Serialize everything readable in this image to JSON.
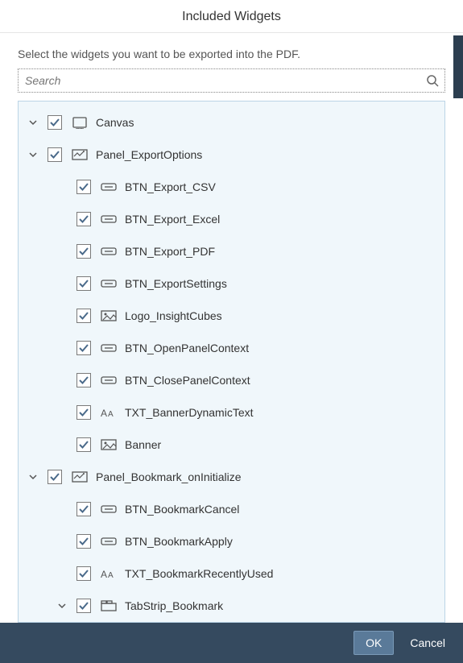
{
  "dialog": {
    "title": "Included Widgets",
    "instructions": "Select the widgets you want to be exported into the PDF."
  },
  "search": {
    "placeholder": "Search"
  },
  "tree": [
    {
      "label": "Canvas",
      "level": 0,
      "checked": true,
      "expandable": true,
      "expanded": true,
      "icon": "canvas"
    },
    {
      "label": "Panel_ExportOptions",
      "level": 1,
      "checked": true,
      "expandable": true,
      "expanded": true,
      "icon": "panel"
    },
    {
      "label": "BTN_Export_CSV",
      "level": 2,
      "checked": true,
      "expandable": false,
      "icon": "button"
    },
    {
      "label": "BTN_Export_Excel",
      "level": 2,
      "checked": true,
      "expandable": false,
      "icon": "button"
    },
    {
      "label": "BTN_Export_PDF",
      "level": 2,
      "checked": true,
      "expandable": false,
      "icon": "button"
    },
    {
      "label": "BTN_ExportSettings",
      "level": 2,
      "checked": true,
      "expandable": false,
      "icon": "button"
    },
    {
      "label": "Logo_InsightCubes",
      "level": 2,
      "checked": true,
      "expandable": false,
      "icon": "image"
    },
    {
      "label": "BTN_OpenPanelContext",
      "level": 2,
      "checked": true,
      "expandable": false,
      "icon": "button"
    },
    {
      "label": "BTN_ClosePanelContext",
      "level": 2,
      "checked": true,
      "expandable": false,
      "icon": "button"
    },
    {
      "label": "TXT_BannerDynamicText",
      "level": 2,
      "checked": true,
      "expandable": false,
      "icon": "text"
    },
    {
      "label": "Banner",
      "level": 2,
      "checked": true,
      "expandable": false,
      "icon": "image"
    },
    {
      "label": "Panel_Bookmark_onInitialize",
      "level": 1,
      "checked": true,
      "expandable": true,
      "expanded": true,
      "icon": "panel"
    },
    {
      "label": "BTN_BookmarkCancel",
      "level": 2,
      "checked": true,
      "expandable": false,
      "icon": "button"
    },
    {
      "label": "BTN_BookmarkApply",
      "level": 2,
      "checked": true,
      "expandable": false,
      "icon": "button"
    },
    {
      "label": "TXT_BookmarkRecentlyUsed",
      "level": 2,
      "checked": true,
      "expandable": false,
      "icon": "text"
    },
    {
      "label": "TabStrip_Bookmark",
      "level": 2,
      "checked": true,
      "expandable": true,
      "expanded": true,
      "icon": "tabstrip"
    }
  ],
  "footer": {
    "ok": "OK",
    "cancel": "Cancel"
  }
}
